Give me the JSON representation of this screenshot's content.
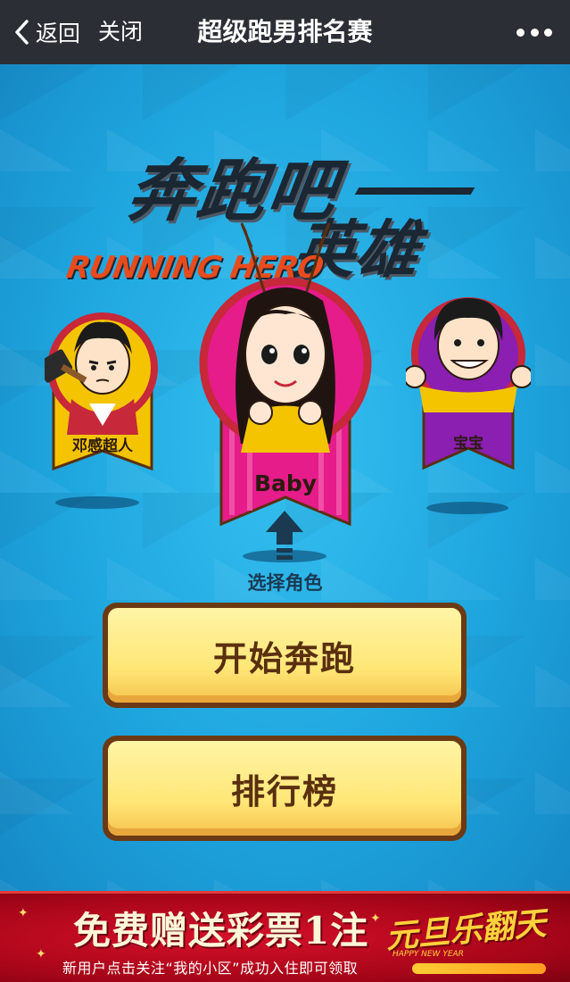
{
  "navbar": {
    "back_label": "返回",
    "close_label": "关闭",
    "title": "超级跑男排名赛"
  },
  "logo": {
    "main": "奔跑吧",
    "sub": "英雄",
    "english": "RUNNING HERO"
  },
  "characters": [
    {
      "name": "邓感超人",
      "ribbon_color": "#f5c400",
      "border_color": "#c7283a"
    },
    {
      "name": "Baby",
      "ribbon_color": "#e51c8a",
      "border_color": "#c7283a",
      "selected": true
    },
    {
      "name": "宝宝",
      "ribbon_color": "#8a1fb1",
      "border_color": "#c7283a"
    }
  ],
  "selector": {
    "label": "选择角色"
  },
  "buttons": {
    "start": "开始奔跑",
    "rank": "排行榜"
  },
  "banner": {
    "title": "免费赠送彩票1注",
    "subtitle": "新用户点击关注“我的小区”成功入住即可领取",
    "promo": "元旦乐翻天",
    "promo_english": "HAPPY NEW YEAR"
  },
  "colors": {
    "navbar_bg": "#2b2e35",
    "stage_bg": "#1fa6df",
    "button_fill": "#ffe676",
    "button_border": "#6b3a14",
    "banner_bg": "#a40518"
  }
}
